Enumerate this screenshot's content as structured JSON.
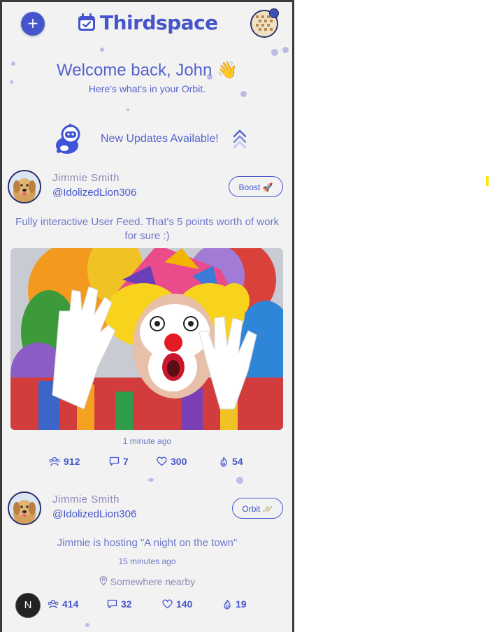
{
  "header": {
    "add_label": "+",
    "brand": "Thirdspace"
  },
  "welcome": {
    "title": "Welcome back, John 👋",
    "subtitle": "Here's what's in your Orbit."
  },
  "updates": {
    "label": "New Updates Available!"
  },
  "posts": [
    {
      "name": "Jimmie Smith",
      "handle": "@IdolizedLion306",
      "action_label": "Boost 🚀",
      "text": "Fully interactive User Feed. That's 5 points worth of work for sure :)",
      "time": "1 minute ago",
      "stats": {
        "people": "912",
        "comments": "7",
        "likes": "300",
        "fire": "54"
      }
    },
    {
      "name": "Jimmie Smith",
      "handle": "@IdolizedLion306",
      "action_label": "Orbit 🪐",
      "text": "Jimmie is hosting \"A night on the town\"",
      "time": "15 minutes ago",
      "location": "Somewhere nearby",
      "stats": {
        "people": "414",
        "comments": "32",
        "likes": "140",
        "fire": "19"
      }
    }
  ],
  "dev_badge": "N",
  "colors": {
    "accent": "#4556cc",
    "text_muted": "#8a8ab8",
    "background": "#f2f2f2"
  }
}
